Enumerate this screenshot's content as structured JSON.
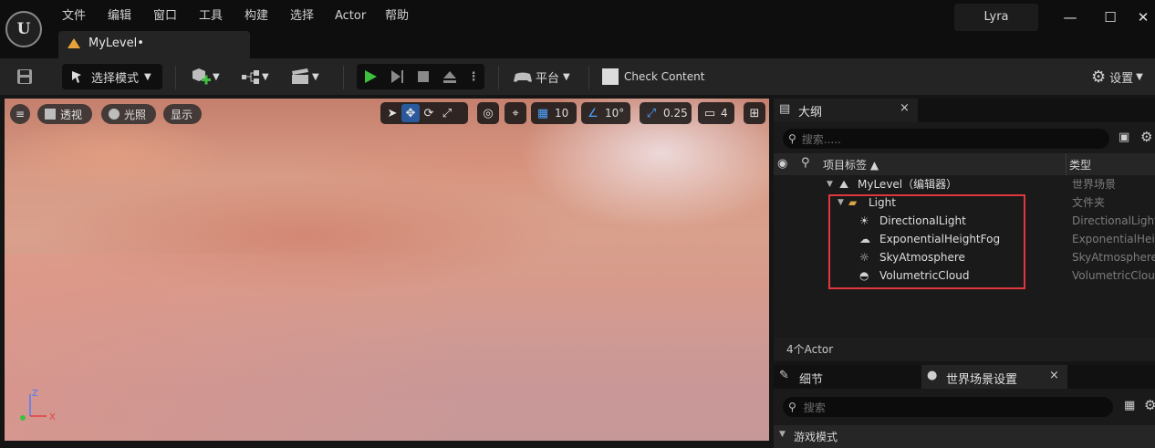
{
  "app": {
    "logo": "U",
    "project": "Lyra"
  },
  "menu": [
    "文件",
    "编辑",
    "窗口",
    "工具",
    "构建",
    "选择",
    "Actor",
    "帮助"
  ],
  "tab": {
    "label": "MyLevel•",
    "icon": "level-icon"
  },
  "window_controls": {
    "minimize": "—",
    "maximize": "☐",
    "close": "✕"
  },
  "toolbar": {
    "save_icon": "save-icon",
    "select_mode": "选择模式",
    "platform": "平台",
    "check_content": "Check Content",
    "settings": "设置"
  },
  "viewport": {
    "menu_icon": "≡",
    "perspective": "透视",
    "lit": "光照",
    "show": "显示",
    "grid_value": "10",
    "angle_value": "10°",
    "scale_value": "0.25",
    "camera_value": "4",
    "axis": {
      "z": "Z",
      "x": "X"
    }
  },
  "outliner": {
    "tab_label": "大纲",
    "close": "×",
    "search_placeholder": "搜索.....",
    "columns": {
      "label": "项目标签 ▲",
      "type": "类型"
    },
    "rows": [
      {
        "name": "MyLevel（编辑器）",
        "type": "世界场景"
      },
      {
        "name": "Light",
        "type": "文件夹"
      },
      {
        "name": "DirectionalLight",
        "type": "DirectionalLight"
      },
      {
        "name": "ExponentialHeightFog",
        "type": "ExponentialHeightFog"
      },
      {
        "name": "SkyAtmosphere",
        "type": "SkyAtmosphere"
      },
      {
        "name": "VolumetricCloud",
        "type": "VolumetricCloud"
      }
    ],
    "status": "4个Actor"
  },
  "details": {
    "tab1": "细节",
    "tab2": "世界场景设置",
    "close": "×",
    "search_placeholder": "搜索",
    "section": "游戏模式"
  },
  "colors": {
    "accent_blue": "#2b5a9c",
    "play_green": "#3fbf3f",
    "highlight_red": "#e0363c",
    "level_icon": "#e8a33a"
  }
}
